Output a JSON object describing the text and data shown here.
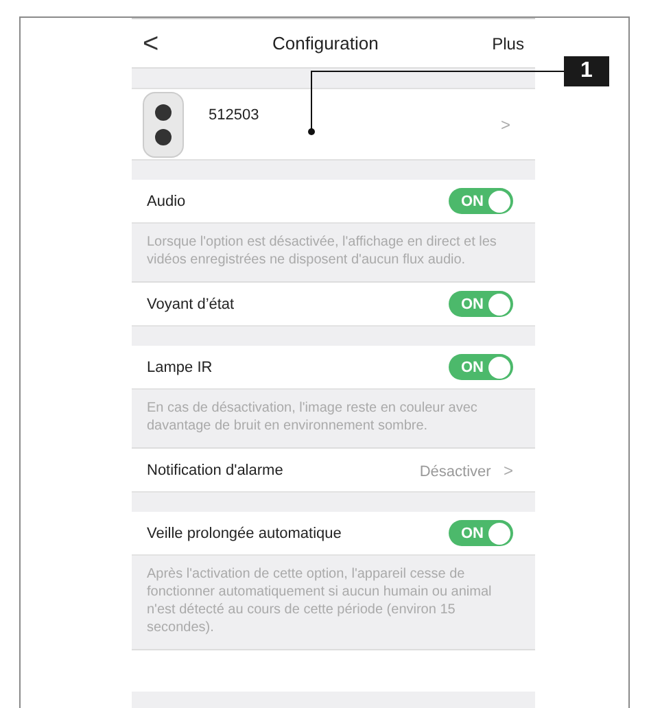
{
  "header": {
    "back": "<",
    "title": "Configuration",
    "action": "Plus"
  },
  "device": {
    "name": "512503",
    "chevron": ">"
  },
  "callout": {
    "label": "1"
  },
  "settings": [
    {
      "kind": "gap"
    },
    {
      "kind": "toggle",
      "label": "Audio",
      "on": true,
      "state_text": "ON"
    },
    {
      "kind": "note",
      "text": "Lorsque l'option est désactivée, l'affichage en direct et les vidéos enregistrées ne disposent d'aucun flux audio."
    },
    {
      "kind": "toggle",
      "label": "Voyant d’état",
      "on": true,
      "state_text": "ON"
    },
    {
      "kind": "gap"
    },
    {
      "kind": "toggle",
      "label": "Lampe IR",
      "on": true,
      "state_text": "ON"
    },
    {
      "kind": "note",
      "text": "En cas de désactivation, l'image reste en couleur avec davantage de bruit en environnement sombre."
    },
    {
      "kind": "link",
      "label": "Notification d'alarme",
      "value": "Désactiver",
      "chevron": ">"
    },
    {
      "kind": "gap"
    },
    {
      "kind": "toggle",
      "label": "Veille prolongée automatique",
      "on": true,
      "state_text": "ON"
    },
    {
      "kind": "note",
      "text": "Après l'activation de cette option, l'appareil cesse de fonctionner automatiquement si aucun humain ou animal n'est détecté au cours de cette période (environ 15 secondes)."
    },
    {
      "kind": "cut_row"
    }
  ]
}
